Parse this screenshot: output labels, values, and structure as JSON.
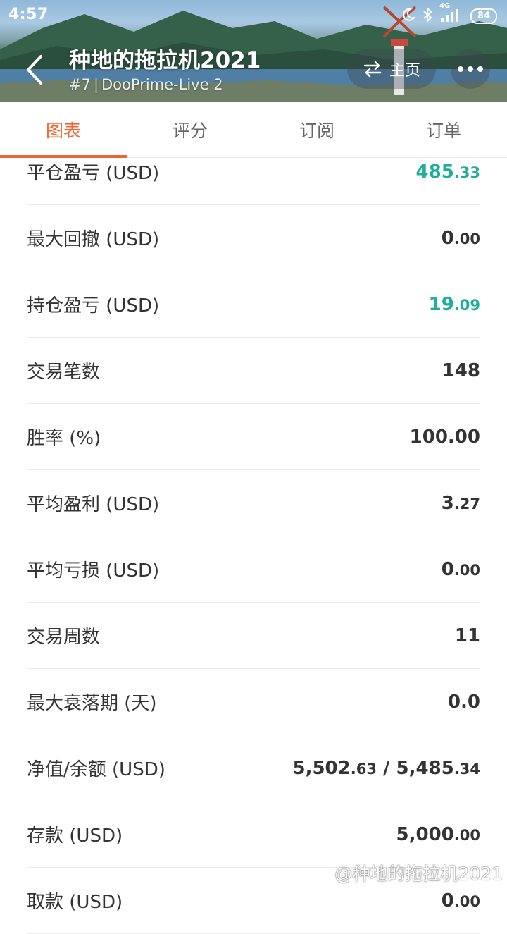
{
  "status_bar": {
    "time": "4:57",
    "network": "4G",
    "battery": "84"
  },
  "header": {
    "title": "种地的拖拉机2021",
    "rank": "#7",
    "server": "DooPrime-Live 2",
    "home_label": "主页"
  },
  "tabs": [
    {
      "label": "图表",
      "active": true
    },
    {
      "label": "评分",
      "active": false
    },
    {
      "label": "订阅",
      "active": false
    },
    {
      "label": "订单",
      "active": false
    }
  ],
  "stats": [
    {
      "label": "平仓盈亏 (USD)",
      "int": "485",
      "dec": ".33",
      "color": "#1fae9a"
    },
    {
      "label": "最大回撤 (USD)",
      "int": "0",
      "dec": ".00",
      "color": ""
    },
    {
      "label": "持仓盈亏 (USD)",
      "int": "19",
      "dec": ".09",
      "color": "#1fae9a"
    },
    {
      "label": "交易笔数",
      "int": "148",
      "dec": "",
      "color": ""
    },
    {
      "label": "胜率 (%)",
      "int": "100.00",
      "dec": "",
      "color": ""
    },
    {
      "label": "平均盈利 (USD)",
      "int": "3",
      "dec": ".27",
      "color": ""
    },
    {
      "label": "平均亏损 (USD)",
      "int": "0",
      "dec": ".00",
      "color": ""
    },
    {
      "label": "交易周数",
      "int": "11",
      "dec": "",
      "color": ""
    },
    {
      "label": "最大衰落期 (天)",
      "int": "0.0",
      "dec": "",
      "color": ""
    },
    {
      "label": "净值/余额 (USD)",
      "int": "5,502",
      "dec": ".63",
      "int2": " / 5,485",
      "dec2": ".34",
      "color": ""
    },
    {
      "label": "存款 (USD)",
      "int": "5,000",
      "dec": ".00",
      "color": ""
    },
    {
      "label": "取款 (USD)",
      "int": "0",
      "dec": ".00",
      "color": ""
    }
  ],
  "watermark": "@种地的拖拉机2021",
  "colors": {
    "accent": "#f0642d",
    "profit_green": "#1fae9a"
  }
}
